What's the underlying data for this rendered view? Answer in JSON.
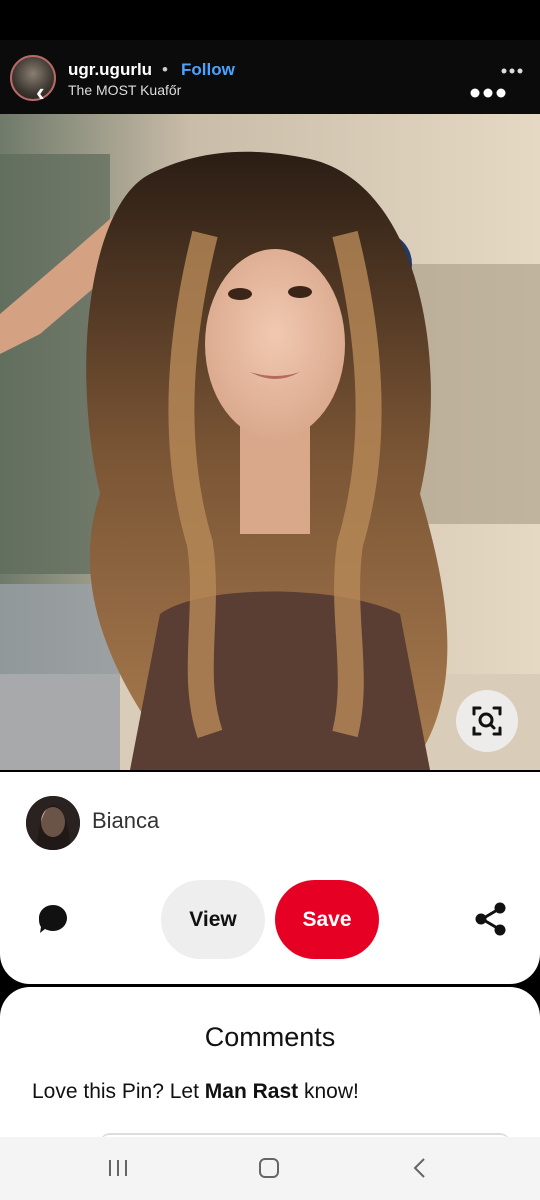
{
  "header": {
    "username": "ugr.ugurlu",
    "separator": "•",
    "follow_label": "Follow",
    "subtitle": "The MOST Kuafőr"
  },
  "pin": {
    "creator_name": "Bianca",
    "view_label": "View",
    "save_label": "Save"
  },
  "comments": {
    "title": "Comments",
    "prompt_prefix": "Love this Pin? Let ",
    "prompt_name": "Man Rast",
    "prompt_suffix": " know!"
  },
  "icons": {
    "back": "chevron-left-icon",
    "more": "more-horizontal-icon",
    "visual_search": "visual-search-icon",
    "comment": "comment-icon",
    "share": "share-icon",
    "nav_recent": "recent-apps-icon",
    "nav_home": "home-icon",
    "nav_back": "back-icon"
  },
  "colors": {
    "save": "#e60023",
    "follow": "#4aa3ff"
  }
}
